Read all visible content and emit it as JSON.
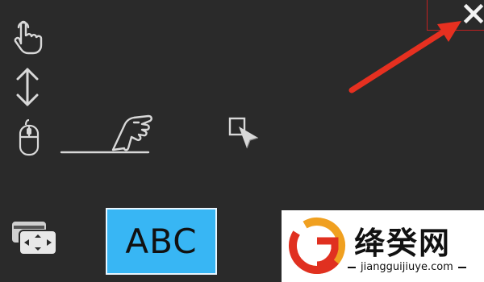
{
  "toolbar": {
    "icons": [
      "touch-tap-icon",
      "vertical-scroll-icon",
      "mouse-icon",
      "swipe-touch-icon",
      "pointer-select-icon",
      "screen-switch-icon"
    ],
    "keyboard_button_label": "ABC"
  },
  "close": {
    "icon": "close-icon",
    "arrow": "red-arrow-annotation"
  },
  "watermark": {
    "brand": "绛癸网",
    "url": "jiangguijiuye.com"
  },
  "colors": {
    "background": "#2a2a2a",
    "keyboard_button": "#38b6f4",
    "arrow": "#e63020",
    "close_border": "#c02020"
  }
}
